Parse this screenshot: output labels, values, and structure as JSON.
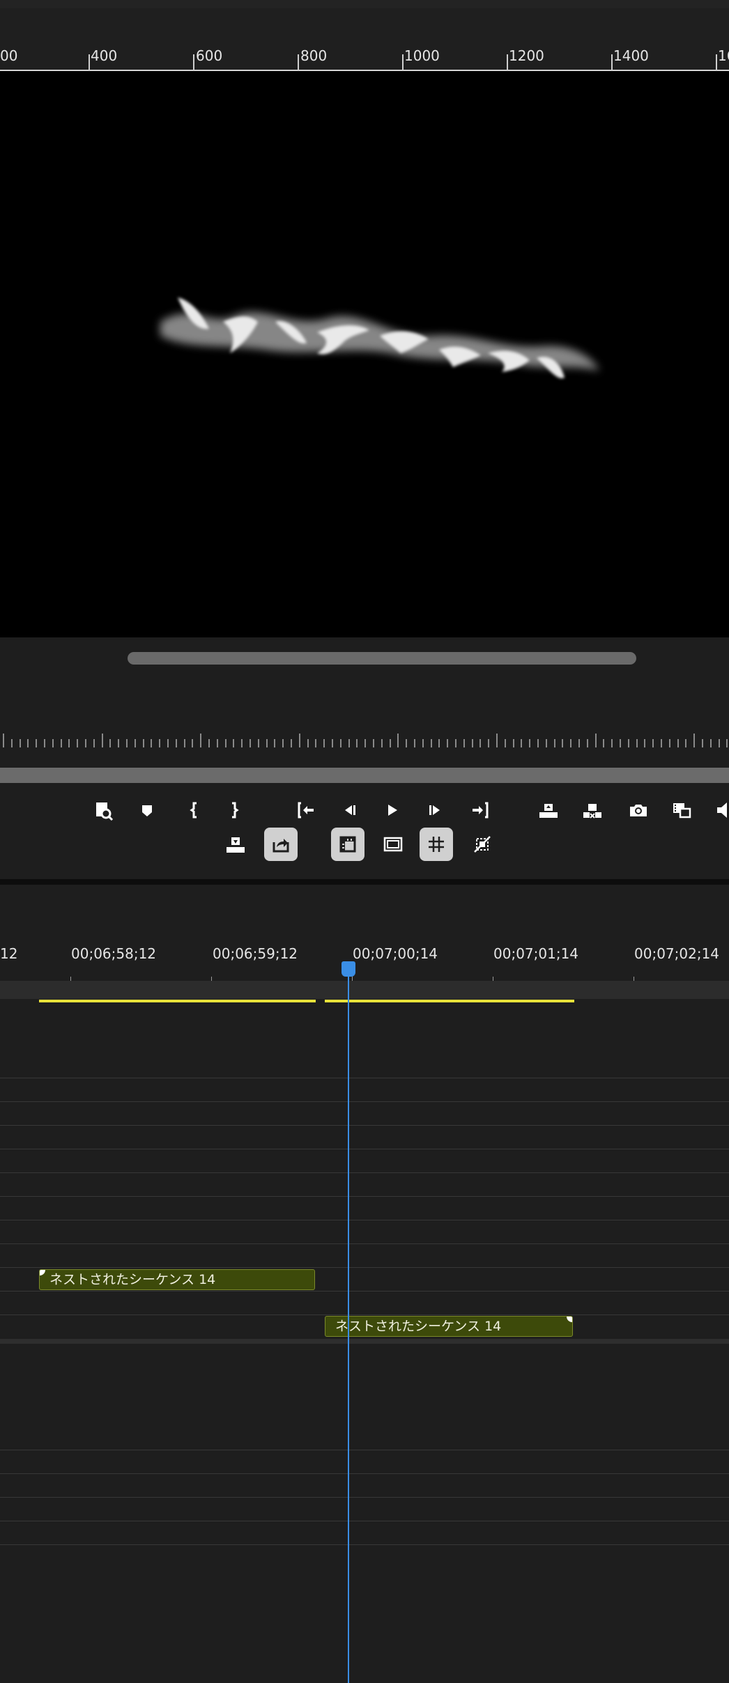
{
  "ruler": {
    "labels": [
      "00",
      "400",
      "600",
      "800",
      "1000",
      "1200",
      "1400",
      "16"
    ]
  },
  "monitor": {
    "content": "ネストされたシーケンス"
  },
  "transport": {
    "row1": [
      {
        "icon": "export-frame-search-icon"
      },
      {
        "icon": "add-marker-icon"
      },
      {
        "icon": "mark-in-icon"
      },
      {
        "icon": "mark-out-icon"
      },
      {
        "icon": "go-to-in-icon"
      },
      {
        "icon": "step-back-icon"
      },
      {
        "icon": "play-icon"
      },
      {
        "icon": "step-forward-icon"
      },
      {
        "icon": "go-to-out-icon"
      },
      {
        "icon": "lift-icon"
      },
      {
        "icon": "extract-icon"
      },
      {
        "icon": "camera-icon"
      },
      {
        "icon": "comparison-view-icon"
      },
      {
        "icon": "volume-icon"
      }
    ],
    "row2": [
      {
        "icon": "insert-icon",
        "active": false
      },
      {
        "icon": "export-icon",
        "active": true
      },
      {
        "icon": "safe-margins-icon",
        "active": true
      },
      {
        "icon": "frame-icon",
        "active": false
      },
      {
        "icon": "grid-icon",
        "active": true
      },
      {
        "icon": "proxy-toggle-icon",
        "active": false
      }
    ]
  },
  "timeline": {
    "timecodes": [
      "12",
      "00;06;58;12",
      "00;06;59;12",
      "00;07;00;14",
      "00;07;01;14",
      "00;07;02;14"
    ],
    "clips": [
      {
        "label": "ネストされたシーケンス 14",
        "track": "upper"
      },
      {
        "label": "ネストされたシーケンス 14",
        "track": "lower"
      }
    ]
  },
  "colors": {
    "accent_playhead": "#3a8ee6",
    "clip_fill": "#3d4a0a",
    "render_bar": "#e8e23a",
    "panel_bg": "#1e1e1e"
  }
}
